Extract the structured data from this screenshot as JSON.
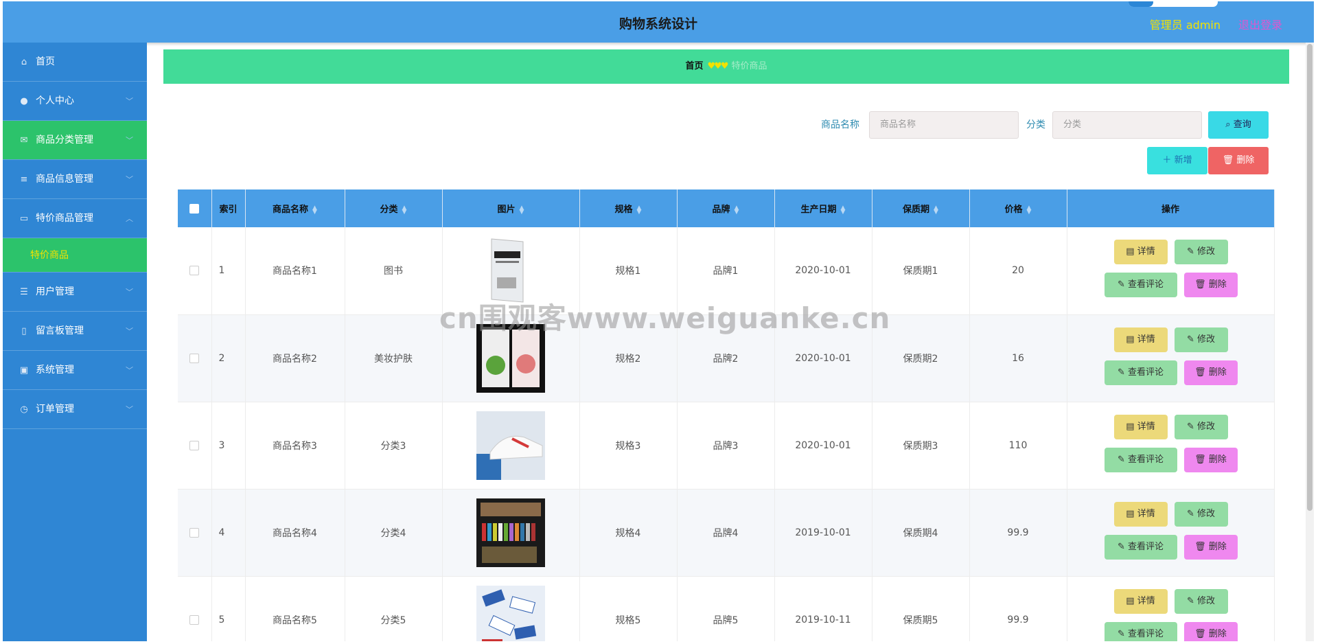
{
  "header": {
    "title": "购物系统设计",
    "admin_label": "管理员 admin",
    "logout_label": "退出登录"
  },
  "sidebar": {
    "items": [
      {
        "label": "首页",
        "icon": "home-icon",
        "glyph": "⌂"
      },
      {
        "label": "个人中心",
        "icon": "user-icon",
        "glyph": "●"
      },
      {
        "label": "商品分类管理",
        "icon": "mail-icon",
        "glyph": "✉",
        "active": true
      },
      {
        "label": "商品信息管理",
        "icon": "list-icon",
        "glyph": "≡"
      },
      {
        "label": "特价商品管理",
        "icon": "monitor-icon",
        "glyph": "▭",
        "expanded": true
      },
      {
        "label": "用户管理",
        "icon": "sliders-icon",
        "glyph": "☰"
      },
      {
        "label": "留言板管理",
        "icon": "microphone-icon",
        "glyph": "▯"
      },
      {
        "label": "系统管理",
        "icon": "clipboard-icon",
        "glyph": "▣"
      },
      {
        "label": "订单管理",
        "icon": "clock-icon",
        "glyph": "◷"
      }
    ],
    "submenu": {
      "label": "特价商品"
    }
  },
  "breadcrumb": {
    "home": "首页",
    "separator": "♥♥♥",
    "current": "特价商品"
  },
  "search": {
    "name_label": "商品名称",
    "name_placeholder": "商品名称",
    "category_label": "分类",
    "category_placeholder": "分类",
    "query_label": "查询"
  },
  "toolbar": {
    "add_label": "新增",
    "delete_label": "删除"
  },
  "table": {
    "headers": [
      "索引",
      "商品名称",
      "分类",
      "图片",
      "规格",
      "品牌",
      "生产日期",
      "保质期",
      "价格",
      "操作"
    ],
    "rows": [
      {
        "index": "1",
        "name": "商品名称1",
        "category": "图书",
        "spec": "规格1",
        "brand": "品牌1",
        "date": "2020-10-01",
        "shelf": "保质期1",
        "price": "20"
      },
      {
        "index": "2",
        "name": "商品名称2",
        "category": "美妆护肤",
        "spec": "规格2",
        "brand": "品牌2",
        "date": "2020-10-01",
        "shelf": "保质期2",
        "price": "16"
      },
      {
        "index": "3",
        "name": "商品名称3",
        "category": "分类3",
        "spec": "规格3",
        "brand": "品牌3",
        "date": "2020-10-01",
        "shelf": "保质期3",
        "price": "110"
      },
      {
        "index": "4",
        "name": "商品名称4",
        "category": "分类4",
        "spec": "规格4",
        "brand": "品牌4",
        "date": "2019-10-01",
        "shelf": "保质期4",
        "price": "99.9"
      },
      {
        "index": "5",
        "name": "商品名称5",
        "category": "分类5",
        "spec": "规格5",
        "brand": "品牌5",
        "date": "2019-10-11",
        "shelf": "保质期5",
        "price": "99.9"
      }
    ],
    "actions": {
      "detail": "详情",
      "edit": "修改",
      "review": "查看评论",
      "remove": "删除"
    }
  },
  "watermark": "cn围观客www.weiguanke.cn",
  "colors": {
    "header": "#4a9ee6",
    "sidebar": "#2f86d4",
    "active": "#2cc36b",
    "breadcrumb": "#42db98",
    "accent_yellow": "#f2e200"
  }
}
